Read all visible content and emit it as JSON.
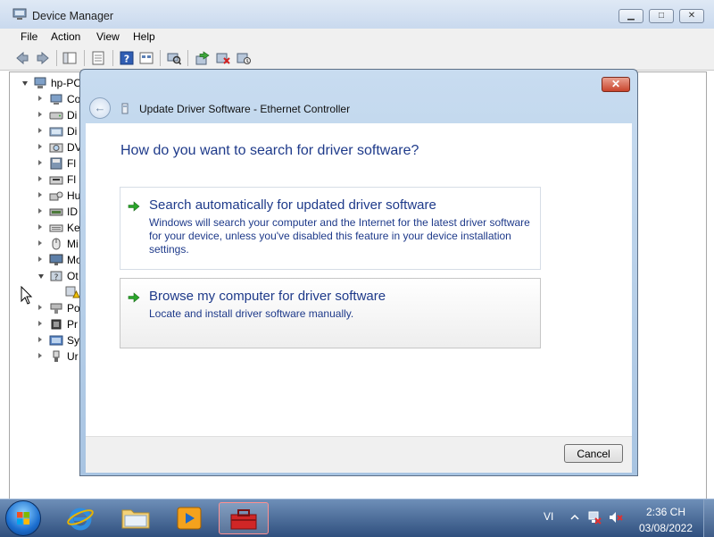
{
  "window": {
    "title": "Device Manager",
    "caption_buttons": {
      "minimize": "▁",
      "maximize": "□",
      "close": "✕"
    }
  },
  "menu": [
    "File",
    "Action",
    "View",
    "Help"
  ],
  "toolbar_icons": [
    "back-icon",
    "forward-icon",
    "show-hide-console-tree-icon",
    "properties-icon",
    "help-icon",
    "view-icon",
    "scan-hardware-icon",
    "update-driver-icon",
    "disable-device-icon",
    "uninstall-device-icon"
  ],
  "tree": {
    "root": "hp-PC",
    "items": [
      {
        "label": "Co",
        "icon": "computer-icon"
      },
      {
        "label": "Di",
        "icon": "disk-drive-icon"
      },
      {
        "label": "Di",
        "icon": "display-adapter-icon"
      },
      {
        "label": "DV",
        "icon": "dvd-drive-icon"
      },
      {
        "label": "Fl",
        "icon": "floppy-controller-icon"
      },
      {
        "label": "Fl",
        "icon": "floppy-drive-icon"
      },
      {
        "label": "Hu",
        "icon": "hid-icon"
      },
      {
        "label": "ID",
        "icon": "ide-controller-icon"
      },
      {
        "label": "Ke",
        "icon": "keyboard-icon"
      },
      {
        "label": "Mi",
        "icon": "mouse-icon"
      },
      {
        "label": "Mo",
        "icon": "monitor-icon"
      },
      {
        "label": "Ot",
        "icon": "other-devices-icon"
      },
      {
        "label": "",
        "icon": "warning-device-icon"
      },
      {
        "label": "Po",
        "icon": "ports-icon"
      },
      {
        "label": "Pr",
        "icon": "processor-icon"
      },
      {
        "label": "Sy",
        "icon": "system-devices-icon"
      },
      {
        "label": "Ur",
        "icon": "usb-controller-icon"
      }
    ]
  },
  "dialog": {
    "close_glyph": "✕",
    "back_glyph": "←",
    "title": "Update Driver Software - Ethernet Controller",
    "heading": "How do you want to search for driver software?",
    "options": [
      {
        "title": "Search automatically for updated driver software",
        "description": "Windows will search your computer and the Internet for the latest driver software for your device, unless you've disabled this feature in your device installation settings."
      },
      {
        "title": "Browse my computer for driver software",
        "description": "Locate and install driver software manually."
      }
    ],
    "cancel_label": "Cancel"
  },
  "taskbar": {
    "apps": [
      "internet-explorer-icon",
      "windows-explorer-icon",
      "media-player-icon",
      "device-manager-toolbox-icon"
    ],
    "language": "VI",
    "time": "2:36 CH",
    "date": "03/08/2022"
  },
  "colors": {
    "dialog_link": "#1e3a8a",
    "dialog_frame": "#b9d1ea",
    "taskbar": "#3b5e8e",
    "close_button": "#c9442c"
  }
}
